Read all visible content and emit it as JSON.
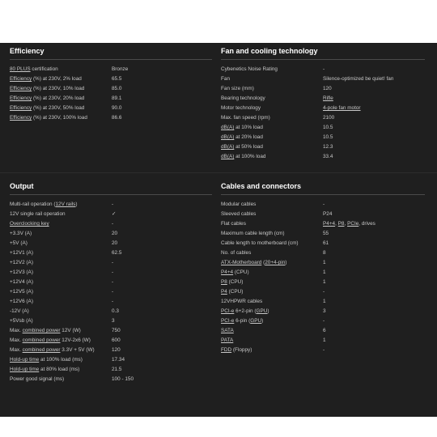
{
  "efficiency": {
    "title": "Efficiency",
    "rows": [
      {
        "label": [
          {
            "t": "80 PLUS",
            "u": true
          },
          {
            "t": " certification",
            "u": false
          }
        ],
        "value": "Bronze"
      },
      {
        "label": [
          {
            "t": "Efficiency",
            "u": true
          },
          {
            "t": " (%) at 230V, 2% load",
            "u": false
          }
        ],
        "value": "65.5"
      },
      {
        "label": [
          {
            "t": "Efficiency",
            "u": true
          },
          {
            "t": " (%) at 230V, 10% load",
            "u": false
          }
        ],
        "value": "85.0"
      },
      {
        "label": [
          {
            "t": "Efficiency",
            "u": true
          },
          {
            "t": " (%) at 230V, 20% load",
            "u": false
          }
        ],
        "value": "89.1"
      },
      {
        "label": [
          {
            "t": "Efficiency",
            "u": true
          },
          {
            "t": " (%) at 230V, 50% load",
            "u": false
          }
        ],
        "value": "90.0"
      },
      {
        "label": [
          {
            "t": "Efficiency",
            "u": true
          },
          {
            "t": " (%) at 230V, 100% load",
            "u": false
          }
        ],
        "value": "86.6"
      }
    ]
  },
  "fan": {
    "title": "Fan and cooling technology",
    "rows": [
      {
        "label": [
          {
            "t": "Cybenetics Noise Rating",
            "u": false
          }
        ],
        "value": "-"
      },
      {
        "label": [
          {
            "t": "Fan",
            "u": false
          }
        ],
        "value": "Silence-optimized be quiet! fan"
      },
      {
        "label": [
          {
            "t": "Fan size (mm)",
            "u": false
          }
        ],
        "value": "120"
      },
      {
        "label": [
          {
            "t": "Bearing technology",
            "u": false
          }
        ],
        "value": [
          {
            "t": "Rifle",
            "u": true
          }
        ]
      },
      {
        "label": [
          {
            "t": "Motor technology",
            "u": false
          }
        ],
        "value": [
          {
            "t": "4-pole fan motor",
            "u": true
          }
        ]
      },
      {
        "label": [
          {
            "t": "Max. fan speed (rpm)",
            "u": false
          }
        ],
        "value": "2100"
      },
      {
        "label": [
          {
            "t": "dB(A)",
            "u": true
          },
          {
            "t": " at 10% load",
            "u": false
          }
        ],
        "value": "10.5"
      },
      {
        "label": [
          {
            "t": "dB(A)",
            "u": true
          },
          {
            "t": " at 20% load",
            "u": false
          }
        ],
        "value": "10.5"
      },
      {
        "label": [
          {
            "t": "dB(A)",
            "u": true
          },
          {
            "t": " at 50% load",
            "u": false
          }
        ],
        "value": "12.3"
      },
      {
        "label": [
          {
            "t": "dB(A)",
            "u": true
          },
          {
            "t": " at 100% load",
            "u": false
          }
        ],
        "value": "33.4"
      }
    ]
  },
  "output": {
    "title": "Output",
    "rows": [
      {
        "label": [
          {
            "t": "Multi-rail operation (",
            "u": false
          },
          {
            "t": "12V rails",
            "u": true
          },
          {
            "t": ")",
            "u": false
          }
        ],
        "value": "-"
      },
      {
        "label": [
          {
            "t": "12V single rail operation",
            "u": false
          }
        ],
        "value": "✓"
      },
      {
        "label": [
          {
            "t": "Overclocking key",
            "u": true
          }
        ],
        "value": "-"
      },
      {
        "label": [
          {
            "t": "+3.3V (A)",
            "u": false
          }
        ],
        "value": "20"
      },
      {
        "label": [
          {
            "t": "+5V (A)",
            "u": false
          }
        ],
        "value": "20"
      },
      {
        "label": [
          {
            "t": "+12V1 (A)",
            "u": false
          }
        ],
        "value": "62.5"
      },
      {
        "label": [
          {
            "t": "+12V2 (A)",
            "u": false
          }
        ],
        "value": "-"
      },
      {
        "label": [
          {
            "t": "+12V3 (A)",
            "u": false
          }
        ],
        "value": "-"
      },
      {
        "label": [
          {
            "t": "+12V4 (A)",
            "u": false
          }
        ],
        "value": "-"
      },
      {
        "label": [
          {
            "t": "+12V5 (A)",
            "u": false
          }
        ],
        "value": "-"
      },
      {
        "label": [
          {
            "t": "+12V6 (A)",
            "u": false
          }
        ],
        "value": "-"
      },
      {
        "label": [
          {
            "t": "-12V (A)",
            "u": false
          }
        ],
        "value": "0.3"
      },
      {
        "label": [
          {
            "t": "+5Vsb (A)",
            "u": false
          }
        ],
        "value": "3"
      },
      {
        "label": [
          {
            "t": "Max. ",
            "u": false
          },
          {
            "t": "combined power",
            "u": true
          },
          {
            "t": " 12V (W)",
            "u": false
          }
        ],
        "value": "750"
      },
      {
        "label": [
          {
            "t": "Max. ",
            "u": false
          },
          {
            "t": "combined power",
            "u": true
          },
          {
            "t": " 12V-2x6 (W)",
            "u": false
          }
        ],
        "value": "600"
      },
      {
        "label": [
          {
            "t": "Max. ",
            "u": false
          },
          {
            "t": "combined power",
            "u": true
          },
          {
            "t": " 3.3V + 5V (W)",
            "u": false
          }
        ],
        "value": "120"
      },
      {
        "label": [
          {
            "t": "Hold-up time",
            "u": true
          },
          {
            "t": " at 100% load (ms)",
            "u": false
          }
        ],
        "value": "17.34"
      },
      {
        "label": [
          {
            "t": "Hold-up time",
            "u": true
          },
          {
            "t": " at 80% load (ms)",
            "u": false
          }
        ],
        "value": "21.5"
      },
      {
        "label": [
          {
            "t": "Power good signal (ms)",
            "u": false
          }
        ],
        "value": "100 - 150"
      }
    ]
  },
  "cables": {
    "title": "Cables and connectors",
    "rows": [
      {
        "label": [
          {
            "t": "Modular cables",
            "u": false
          }
        ],
        "value": "-"
      },
      {
        "label": [
          {
            "t": "Sleeved cables",
            "u": false
          }
        ],
        "value": "P24"
      },
      {
        "label": [
          {
            "t": "Flat cables",
            "u": false
          }
        ],
        "value": [
          {
            "t": "P4+4",
            "u": true
          },
          {
            "t": ", ",
            "u": false
          },
          {
            "t": "P8",
            "u": true
          },
          {
            "t": ", ",
            "u": false
          },
          {
            "t": "PCIe",
            "u": true
          },
          {
            "t": ", drives",
            "u": false
          }
        ]
      },
      {
        "label": [
          {
            "t": "Maximum cable length (cm)",
            "u": false
          }
        ],
        "value": "55"
      },
      {
        "label": [
          {
            "t": "Cable length to motherboard (cm)",
            "u": false
          }
        ],
        "value": "61"
      },
      {
        "label": [
          {
            "t": "No. of cables",
            "u": false
          }
        ],
        "value": "8"
      },
      {
        "label": [
          {
            "t": "ATX-Motherboard",
            "u": true
          },
          {
            "t": " (",
            "u": false
          },
          {
            "t": "20+4-pin",
            "u": true
          },
          {
            "t": ")",
            "u": false
          }
        ],
        "value": "1"
      },
      {
        "label": [
          {
            "t": "P4+4",
            "u": true
          },
          {
            "t": " (CPU)",
            "u": false
          }
        ],
        "value": "1"
      },
      {
        "label": [
          {
            "t": "P8",
            "u": true
          },
          {
            "t": " (CPU)",
            "u": false
          }
        ],
        "value": "1"
      },
      {
        "label": [
          {
            "t": "P4",
            "u": true
          },
          {
            "t": " (CPU)",
            "u": false
          }
        ],
        "value": "-"
      },
      {
        "label": [
          {
            "t": "12VHPWR cables",
            "u": false
          }
        ],
        "value": "1"
      },
      {
        "label": [
          {
            "t": "PCI-e",
            "u": true
          },
          {
            "t": " 6+2-pin (",
            "u": false
          },
          {
            "t": "GPU",
            "u": true
          },
          {
            "t": ")",
            "u": false
          }
        ],
        "value": "3"
      },
      {
        "label": [
          {
            "t": "PCI-e",
            "u": true
          },
          {
            "t": " 6-pin (",
            "u": false
          },
          {
            "t": "GPU",
            "u": true
          },
          {
            "t": ")",
            "u": false
          }
        ],
        "value": "-"
      },
      {
        "label": [
          {
            "t": "SATA",
            "u": true
          }
        ],
        "value": "6"
      },
      {
        "label": [
          {
            "t": "PATA",
            "u": true
          }
        ],
        "value": "1"
      },
      {
        "label": [
          {
            "t": "FDD",
            "u": true
          },
          {
            "t": " (Floppy)",
            "u": false
          }
        ],
        "value": "-"
      }
    ]
  }
}
